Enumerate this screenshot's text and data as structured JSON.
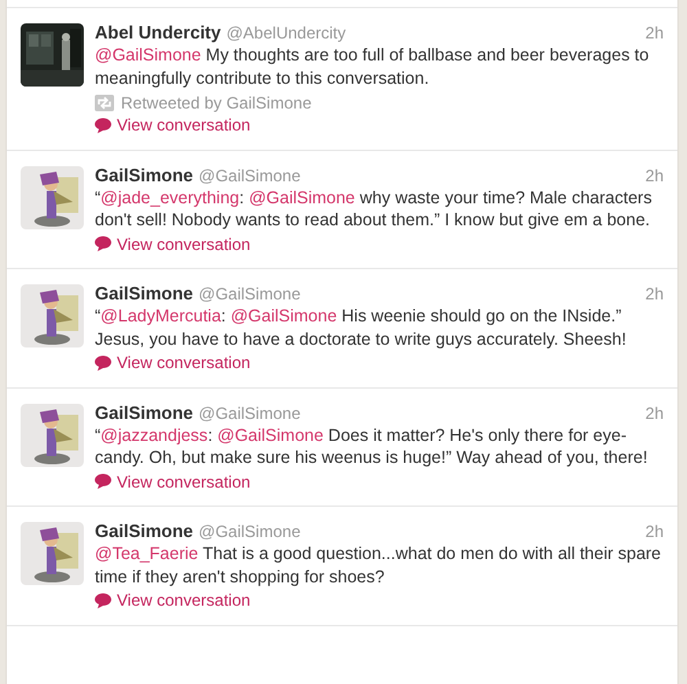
{
  "tweets": [
    {
      "name": "Abel Undercity",
      "handle": "@AbelUndercity",
      "time": "2h",
      "segments": [
        {
          "kind": "mention",
          "text": "@GailSimone"
        },
        {
          "kind": "plain",
          "text": " My thoughts are too full of ballbase and beer beverages to meaningfully contribute to this conversation."
        }
      ],
      "retweeted_by": "Retweeted by GailSimone",
      "action": "View conversation"
    },
    {
      "name": "GailSimone",
      "handle": "@GailSimone",
      "time": "2h",
      "segments": [
        {
          "kind": "plain",
          "text": "“"
        },
        {
          "kind": "mention",
          "text": "@jade_everything"
        },
        {
          "kind": "plain",
          "text": ": "
        },
        {
          "kind": "mention",
          "text": "@GailSimone"
        },
        {
          "kind": "plain",
          "text": " why waste your time? Male characters don't sell! Nobody wants to read about them.” I know but give em a bone."
        }
      ],
      "action": "View conversation"
    },
    {
      "name": "GailSimone",
      "handle": "@GailSimone",
      "time": "2h",
      "segments": [
        {
          "kind": "plain",
          "text": "“"
        },
        {
          "kind": "mention",
          "text": "@LadyMercutia"
        },
        {
          "kind": "plain",
          "text": ": "
        },
        {
          "kind": "mention",
          "text": "@GailSimone"
        },
        {
          "kind": "plain",
          "text": " His weenie should go on the INside.” Jesus, you have to have a doctorate to write guys accurately. Sheesh!"
        }
      ],
      "action": "View conversation"
    },
    {
      "name": "GailSimone",
      "handle": "@GailSimone",
      "time": "2h",
      "segments": [
        {
          "kind": "plain",
          "text": "“"
        },
        {
          "kind": "mention",
          "text": "@jazzandjess"
        },
        {
          "kind": "plain",
          "text": ": "
        },
        {
          "kind": "mention",
          "text": "@GailSimone"
        },
        {
          "kind": "plain",
          "text": " Does it matter? He's only there for eye-candy. Oh, but make sure his weenus is huge!” Way ahead of you, there!"
        }
      ],
      "action": "View conversation"
    },
    {
      "name": "GailSimone",
      "handle": "@GailSimone",
      "time": "2h",
      "segments": [
        {
          "kind": "mention",
          "text": "@Tea_Faerie"
        },
        {
          "kind": "plain",
          "text": " That is a good question...what do men do with all their spare time if they aren't shopping for shoes?"
        }
      ],
      "action": "View conversation"
    }
  ]
}
